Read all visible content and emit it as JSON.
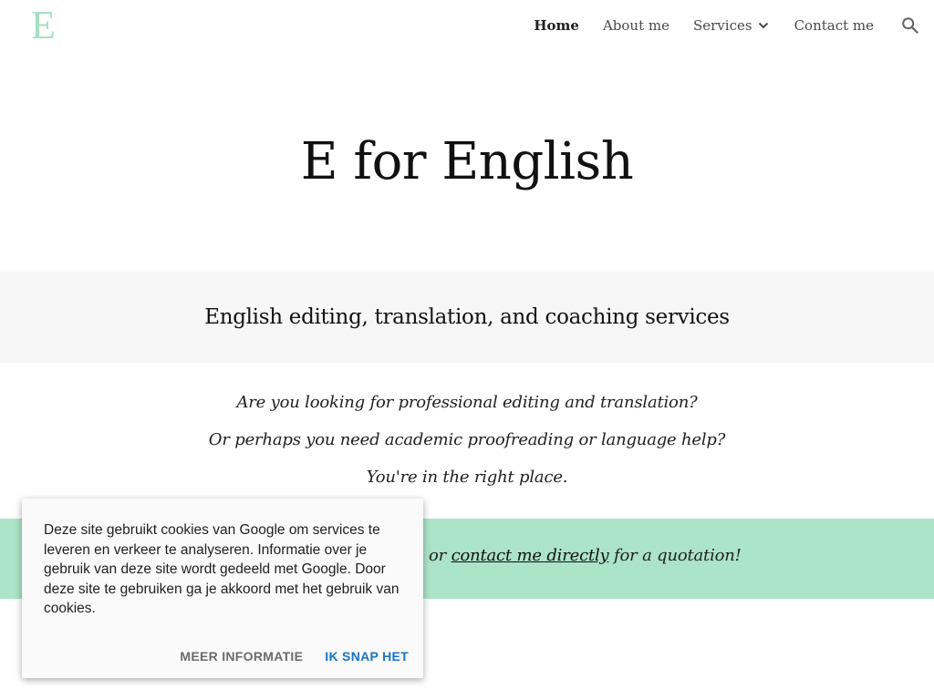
{
  "header": {
    "logo": "E",
    "nav": [
      {
        "label": "Home",
        "active": true
      },
      {
        "label": "About me",
        "active": false
      },
      {
        "label": "Services",
        "active": false,
        "has_dropdown": true
      },
      {
        "label": "Contact me",
        "active": false
      }
    ],
    "search_icon": "search-icon",
    "dropdown_icon": "chevron-down-icon"
  },
  "hero": {
    "title": "E for English"
  },
  "subtitle": "English editing, translation, and coaching services",
  "intro": [
    "Are you looking for professional editing and translation?",
    "Or perhaps you need academic proofreading or language help?",
    "You're in the right place."
  ],
  "cta": {
    "prefix": "or ",
    "link": "contact me directly",
    "suffix": " for a quotation!"
  },
  "cookie": {
    "text": "Deze site gebruikt cookies van Google om services te leveren en verkeer te analyseren. Informatie over je gebruik van deze site wordt gedeeld met Google. Door deze site te gebruiken ga je akkoord met het gebruik van cookies.",
    "more_label": "MEER INFORMATIE",
    "ok_label": "IK SNAP HET"
  },
  "colors": {
    "logo": "#a6dfc3",
    "green_band": "#ace4c8",
    "subtitle_band": "#f7f7f7",
    "accent_link": "#1a73c4"
  }
}
